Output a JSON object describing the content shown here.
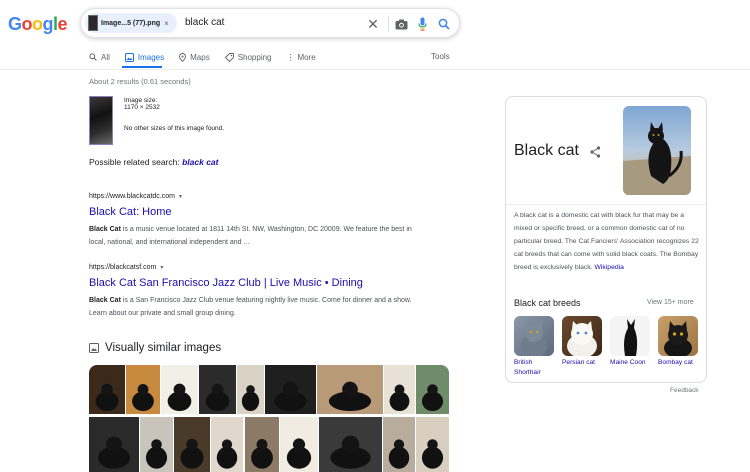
{
  "logo": {
    "letters": [
      "G",
      "o",
      "o",
      "g",
      "l",
      "e"
    ],
    "colors": [
      "#4285f4",
      "#ea4335",
      "#fbbc05",
      "#4285f4",
      "#34a853",
      "#ea4335"
    ]
  },
  "search": {
    "image_chip_name": "Image...5 (77).png",
    "image_chip_remove": "×",
    "query": "black cat",
    "clear_glyph": "✕",
    "accent": "#1a73e8"
  },
  "tabs": [
    {
      "label": "All",
      "icon": "search-icon"
    },
    {
      "label": "Images",
      "icon": "image-icon",
      "active": true
    },
    {
      "label": "Maps",
      "icon": "map-pin-icon"
    },
    {
      "label": "Shopping",
      "icon": "tag-icon"
    },
    {
      "label": "More",
      "icon": "more-vertical-icon"
    }
  ],
  "more_prefix": "⋮",
  "tools_label": "Tools",
  "result_stats": "About 2 results (0.61 seconds)",
  "uploaded": {
    "size_label": "Image size:",
    "size_value": "1170 × 2532",
    "no_other_sizes": "No other sizes of this image found."
  },
  "related": {
    "label": "Possible related search:",
    "query": "black cat"
  },
  "results": [
    {
      "url": "https://www.blackcatdc.com",
      "caret": "▾",
      "title": "Black Cat: Home",
      "snippet_bold": "Black Cat",
      "snippet_rest": " is a music venue located at 1811 14th St. NW, Washington, DC 20009. We feature the best in local, national, and international independent and ..."
    },
    {
      "url": "https://blackcatsf.com",
      "caret": "▾",
      "title": "Black Cat San Francisco Jazz Club | Live Music • Dining",
      "snippet_bold": "Black Cat",
      "snippet_rest": " is a San Francisco Jazz Club venue featuring nightly live music. Come for dinner and a show. Learn about our private and small group dining."
    }
  ],
  "visually_similar": {
    "heading": "Visually similar images",
    "row1_count": 12,
    "row2_count": 11
  },
  "knowledge_panel": {
    "title": "Black cat",
    "description": "A black cat is a domestic cat with black fur that may be a mixed or specific breed, or a common domestic cat of no particular breed. The Cat Fanciers' Association recognizes 22 cat breeds that can come with solid black coats. The Bombay breed is exclusively black.",
    "source": "Wikipedia",
    "breeds_heading": "Black cat breeds",
    "view_more": "View 15+ more",
    "breeds": [
      {
        "name": "British Shorthair"
      },
      {
        "name": "Persian cat"
      },
      {
        "name": "Maine Coon"
      },
      {
        "name": "Bombay cat"
      }
    ]
  },
  "feedback": "Feedback"
}
